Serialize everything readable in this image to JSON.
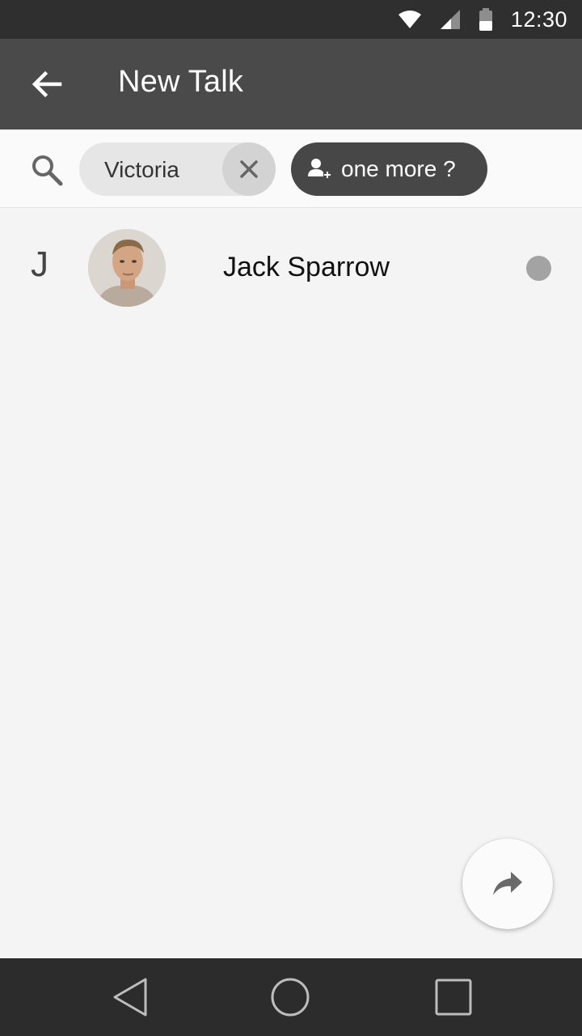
{
  "status_bar": {
    "time": "12:30",
    "background": "#2f2f2f"
  },
  "app_bar": {
    "title": "New Talk",
    "background": "#4a4a4a",
    "back_icon": "arrow-back-icon"
  },
  "search": {
    "icon": "search-icon",
    "chip": {
      "label": "Victoria",
      "remove_icon": "close-icon"
    },
    "add_chip": {
      "label": "one more ?",
      "icon": "add-person-icon"
    }
  },
  "contacts": [
    {
      "letter": "J",
      "name": "Jack Sparrow",
      "presence_color": "#a3a3a3"
    }
  ],
  "fab": {
    "icon": "forward-icon"
  },
  "nav_bar": {
    "icons": [
      "back-triangle-icon",
      "home-circle-icon",
      "recents-square-icon"
    ]
  }
}
